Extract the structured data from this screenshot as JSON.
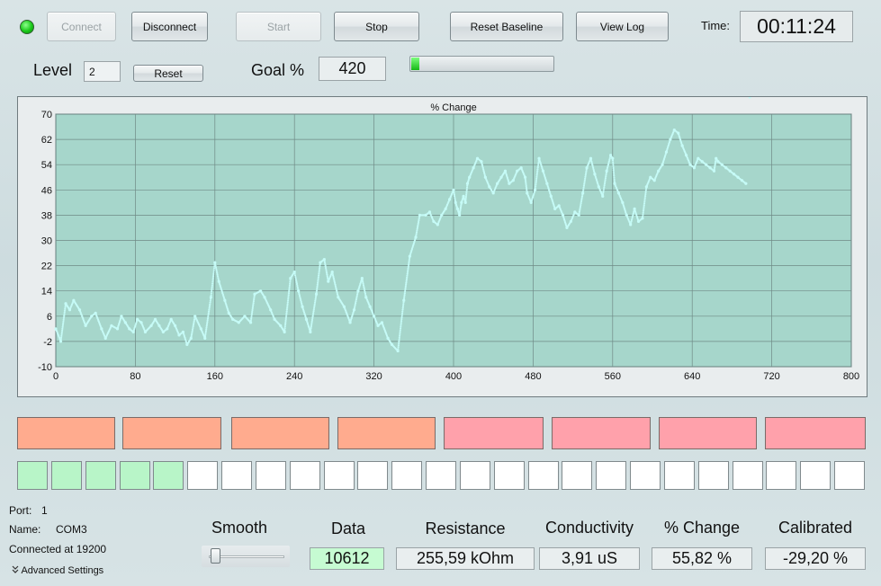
{
  "toolbar": {
    "connect_label": "Connect",
    "disconnect_label": "Disconnect",
    "start_label": "Start",
    "stop_label": "Stop",
    "reset_baseline_label": "Reset Baseline",
    "view_log_label": "View Log",
    "time_label": "Time:",
    "time_value": "00:11:24",
    "status_color": "#18c818"
  },
  "level": {
    "label": "Level",
    "value": "2",
    "reset_label": "Reset"
  },
  "goal": {
    "label": "Goal %",
    "value": "420",
    "progress_fraction": 0.06
  },
  "zones": {
    "colors": [
      "#ffab8e",
      "#ffab8e",
      "#ffab8e",
      "#ffab8e",
      "#ffa1ab",
      "#ffa1ab",
      "#ffa1ab",
      "#ffa1ab"
    ]
  },
  "cells": {
    "count": 25,
    "filled": 5,
    "fill_color": "#b8f5c8"
  },
  "port": {
    "port_label": "Port:",
    "port_value": "1",
    "name_label": "Name:",
    "name_value": "COM3",
    "connected_text": "Connected at 19200",
    "advanced_label": "Advanced Settings"
  },
  "readouts": {
    "smooth_label": "Smooth",
    "smooth_value": 0.05,
    "data_label": "Data",
    "data_value": "10612",
    "resistance_label": "Resistance",
    "resistance_value": "255,59 kOhm",
    "conductivity_label": "Conductivity",
    "conductivity_value": "3,91 uS",
    "change_label": "% Change",
    "change_value": "55,82 %",
    "calibrated_label": "Calibrated",
    "calibrated_value": "-29,20 %"
  },
  "chart_data": {
    "type": "scatter",
    "title": "% Change",
    "xlim": [
      0,
      800
    ],
    "ylim": [
      -10,
      70
    ],
    "xticks": [
      0,
      80,
      160,
      240,
      320,
      400,
      480,
      560,
      640,
      720,
      800
    ],
    "yticks": [
      -10,
      -2,
      6,
      14,
      22,
      30,
      38,
      46,
      54,
      62,
      70
    ],
    "grid": true,
    "point_color": "#c6fbf7",
    "x": [
      0,
      5,
      10,
      14,
      18,
      24,
      30,
      36,
      40,
      46,
      50,
      56,
      62,
      66,
      70,
      74,
      78,
      82,
      86,
      90,
      96,
      100,
      104,
      108,
      112,
      116,
      120,
      124,
      128,
      132,
      136,
      140,
      146,
      150,
      156,
      160,
      164,
      170,
      174,
      178,
      184,
      190,
      196,
      200,
      206,
      210,
      216,
      220,
      226,
      230,
      236,
      240,
      244,
      248,
      252,
      256,
      262,
      266,
      270,
      274,
      278,
      284,
      290,
      296,
      300,
      304,
      308,
      312,
      316,
      320,
      324,
      328,
      334,
      338,
      344,
      350,
      356,
      362,
      366,
      372,
      376,
      380,
      384,
      388,
      392,
      396,
      400,
      402,
      404,
      406,
      408,
      410,
      412,
      414,
      416,
      420,
      424,
      428,
      432,
      436,
      440,
      444,
      448,
      452,
      456,
      460,
      464,
      468,
      472,
      474,
      478,
      482,
      486,
      490,
      494,
      498,
      502,
      506,
      510,
      514,
      518,
      522,
      526,
      530,
      534,
      538,
      542,
      546,
      550,
      554,
      558,
      560,
      562,
      566,
      570,
      574,
      578,
      582,
      586,
      590,
      594,
      598,
      602,
      606,
      610,
      614,
      618,
      622,
      626,
      630,
      634,
      638,
      642,
      646,
      650,
      654,
      658,
      662,
      664,
      666,
      670,
      674,
      678,
      682,
      686,
      690,
      694,
      698
    ],
    "y": [
      2,
      -2,
      10,
      8,
      11,
      8,
      3,
      6,
      7,
      2,
      -1,
      3,
      2,
      6,
      4,
      2,
      1,
      5,
      4,
      1,
      3,
      5,
      3,
      1,
      2,
      5,
      3,
      0,
      1,
      -3,
      -1,
      6,
      2,
      -1,
      12,
      23,
      17,
      11,
      7,
      5,
      4,
      6,
      4,
      13,
      14,
      12,
      8,
      5,
      3,
      1,
      18,
      20,
      14,
      9,
      5,
      1,
      13,
      23,
      24,
      17,
      20,
      12,
      9,
      4,
      8,
      14,
      18,
      12,
      9,
      6,
      3,
      4,
      -1,
      -3,
      -5,
      11,
      25,
      31,
      38,
      38,
      39,
      36,
      35,
      38,
      40,
      43,
      46,
      42,
      40,
      38,
      42,
      44,
      42,
      48,
      50,
      53,
      56,
      55,
      50,
      47,
      45,
      48,
      50,
      52,
      48,
      49,
      52,
      53,
      50,
      45,
      42,
      46,
      56,
      52,
      48,
      44,
      40,
      41,
      38,
      34,
      36,
      39,
      38,
      45,
      53,
      56,
      51,
      47,
      44,
      52,
      57,
      56,
      48,
      45,
      42,
      38,
      35,
      40,
      36,
      37,
      47,
      50,
      49,
      52,
      54,
      58,
      62,
      65,
      64,
      60,
      57,
      54,
      53,
      56,
      55,
      54,
      53,
      52,
      56,
      55,
      54,
      53,
      52,
      51,
      50,
      49,
      48
    ],
    "note_segments": []
  }
}
